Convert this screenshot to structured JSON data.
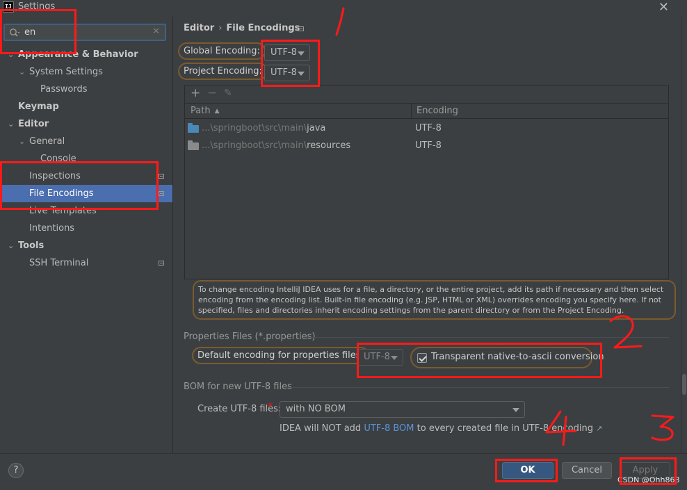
{
  "window": {
    "title": "Settings",
    "app_icon": "IJ"
  },
  "search": {
    "value": "en",
    "icon": "search-icon",
    "clear_icon": "close-icon"
  },
  "tree": {
    "appearance": "Appearance & Behavior",
    "system_settings": "System Settings",
    "passwords": "Passwords",
    "keymap": "Keymap",
    "editor": "Editor",
    "general": "General",
    "console": "Console",
    "inspections": "Inspections",
    "file_encodings": "File Encodings",
    "live_templates": "Live Templates",
    "intentions": "Intentions",
    "tools": "Tools",
    "ssh_terminal": "SSH Terminal"
  },
  "breadcrumb": {
    "parent": "Editor",
    "sep": "›",
    "current": "File Encodings"
  },
  "encoding": {
    "global_label": "Global Encoding:",
    "global_value": "UTF-8",
    "project_label": "Project Encoding:",
    "project_value": "UTF-8"
  },
  "table": {
    "toolbar": {
      "add": "+",
      "remove": "−",
      "edit": "✎"
    },
    "headers": {
      "path": "Path",
      "sort": "▲",
      "encoding": "Encoding"
    },
    "rows": [
      {
        "path_prefix": "...\\springboot\\src\\main\\",
        "path_leaf": "java",
        "encoding": "UTF-8",
        "folder_color": "#4a88b5"
      },
      {
        "path_prefix": "...\\springboot\\src\\main\\",
        "path_leaf": "resources",
        "encoding": "UTF-8",
        "folder_color": "#8a8a8a"
      }
    ]
  },
  "info_text": "To change encoding IntelliJ IDEA uses for a file, a directory, or the entire project, add its path if necessary and then select encoding from the encoding list. Built-in file encoding (e.g. JSP, HTML or XML) overrides encoding you specify here. If not specified, files and directories inherit encoding settings from the parent directory or from the Project Encoding.",
  "properties": {
    "section_title": "Properties Files (*.properties)",
    "default_label": "Default encoding for properties files:",
    "default_value": "UTF-8",
    "transparent_label": "Transparent native-to-ascii conversion",
    "transparent_checked": true
  },
  "bom": {
    "section_title": "BOM for new UTF-8 files",
    "create_label": "Create UTF-8 files:",
    "required_mark": "*",
    "create_value": "with NO BOM",
    "note_prefix": "IDEA will NOT add ",
    "note_link": "UTF-8 BOM",
    "note_suffix": " to every created file in UTF-8 encoding ",
    "note_arrow": "↗"
  },
  "buttons": {
    "help": "?",
    "ok": "OK",
    "cancel": "Cancel",
    "apply": "Apply"
  },
  "watermark": "CSDN @Ohh868",
  "annotations": {
    "marks": [
      "1",
      "2",
      "3",
      "4"
    ],
    "color": "#ff1a1a"
  }
}
